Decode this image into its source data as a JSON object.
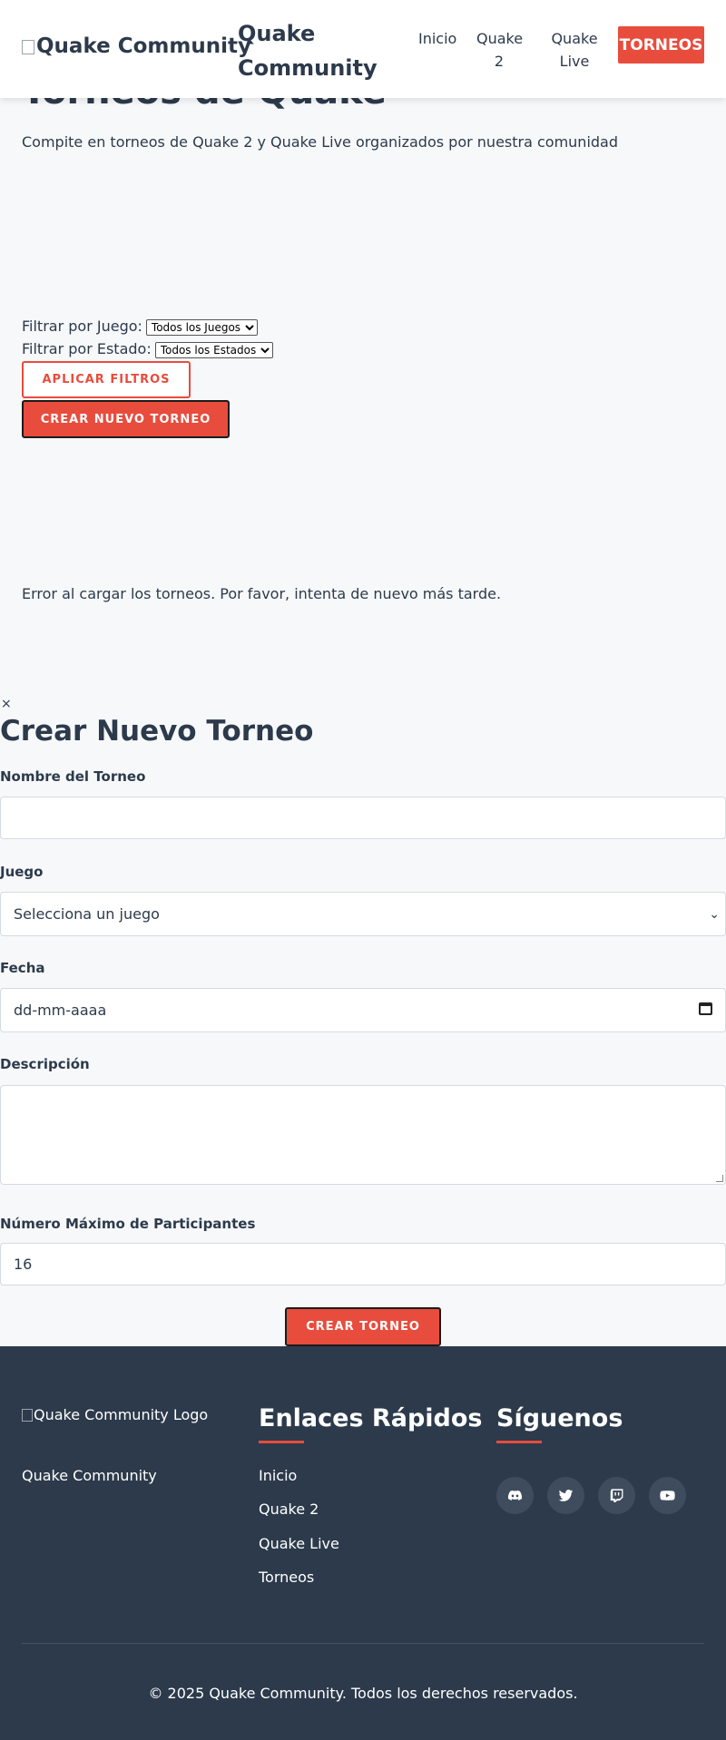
{
  "header": {
    "logo_alt": "Quake Community",
    "brand": "Quake Community",
    "nav": [
      {
        "label": "Inicio"
      },
      {
        "label": "Quake 2"
      },
      {
        "label": "Quake Live"
      },
      {
        "label": "TORNEOS"
      }
    ]
  },
  "main": {
    "title": "Torneos de Quake",
    "subtitle": "Compite en torneos de Quake 2 y Quake Live organizados por nuestra comunidad",
    "filters": {
      "game_label": "Filtrar por Juego:",
      "game_selected": "Todos los Juegos",
      "status_label": "Filtrar por Estado:",
      "status_selected": "Todos los Estados",
      "apply_label": "APLICAR FILTROS",
      "create_label": "CREAR NUEVO TORNEO"
    },
    "error_message": "Error al cargar los torneos. Por favor, intenta de nuevo más tarde."
  },
  "form": {
    "close": "×",
    "title": "Crear Nuevo Torneo",
    "name_label": "Nombre del Torneo",
    "name_value": "",
    "game_label": "Juego",
    "game_selected": "Selecciona un juego",
    "date_label": "Fecha",
    "date_placeholder": "dd-mm-aaaa",
    "description_label": "Descripción",
    "description_value": "",
    "max_label": "Número Máximo de Participantes",
    "max_value": "16",
    "submit_label": "CREAR TORNEO"
  },
  "footer": {
    "logo_alt": "Quake Community Logo",
    "brand": "Quake Community",
    "links_heading": "Enlaces Rápidos",
    "links": [
      {
        "label": "Inicio"
      },
      {
        "label": "Quake 2"
      },
      {
        "label": "Quake Live"
      },
      {
        "label": "Torneos"
      }
    ],
    "social_heading": "Síguenos",
    "social": [
      {
        "icon": "discord-icon"
      },
      {
        "icon": "twitter-icon"
      },
      {
        "icon": "twitch-icon"
      },
      {
        "icon": "youtube-icon"
      }
    ],
    "copyright": "© 2025 Quake Community. Todos los derechos reservados."
  },
  "colors": {
    "accent": "#e84c3d",
    "text": "#2c3a4b",
    "footer_bg": "#2c3a4b",
    "page_bg": "#f7f8fa"
  }
}
